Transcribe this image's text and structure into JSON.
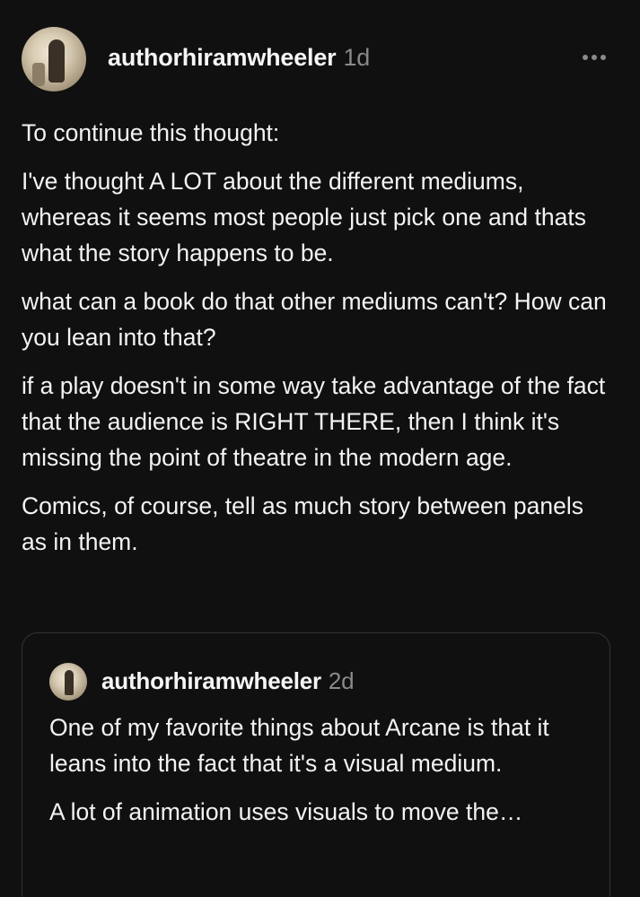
{
  "post": {
    "username": "authorhiramwheeler",
    "time": "1d",
    "more_icon": "ellipsis-icon",
    "paragraphs": [
      "To continue this thought:",
      "I've thought A LOT about the different mediums, whereas it seems most people just pick one and thats what the story happens to be.",
      "what can a book do that other mediums can't? How can you lean into that?",
      "if a play doesn't in some way take advantage of the fact that the audience is RIGHT THERE, then I think it's missing the point of theatre in the modern age.",
      "Comics, of course, tell as much story between panels as in them."
    ]
  },
  "quoted": {
    "username": "authorhiramwheeler",
    "time": "2d",
    "paragraphs": [
      "One of my favorite things about Arcane is that it leans into the fact that it's a visual medium.",
      "A lot of animation uses visuals to move the…"
    ]
  }
}
